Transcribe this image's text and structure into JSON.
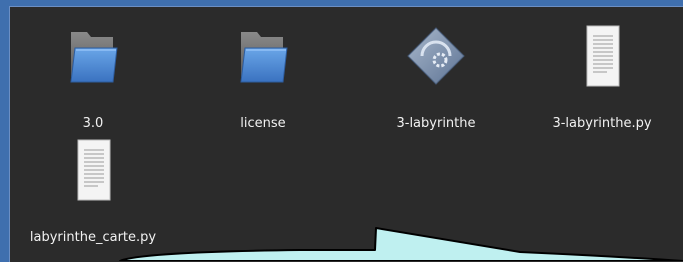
{
  "desktop": {
    "background_color": "#3f6fae",
    "window_background": "#2b2b2b",
    "items": [
      {
        "label": "3.0",
        "icon": "folder-icon",
        "kind": "folder"
      },
      {
        "label": "license",
        "icon": "folder-icon",
        "kind": "folder"
      },
      {
        "label": "3-labyrinthe",
        "icon": "executable-icon",
        "kind": "executable"
      },
      {
        "label": "3-labyrinthe.py",
        "icon": "text-document-icon",
        "kind": "document"
      },
      {
        "label": "labyrinthe_carte.py",
        "icon": "text-document-icon",
        "kind": "document"
      }
    ]
  },
  "callout": {
    "fill": "#bff0f0",
    "icon": "speech-bubble"
  }
}
